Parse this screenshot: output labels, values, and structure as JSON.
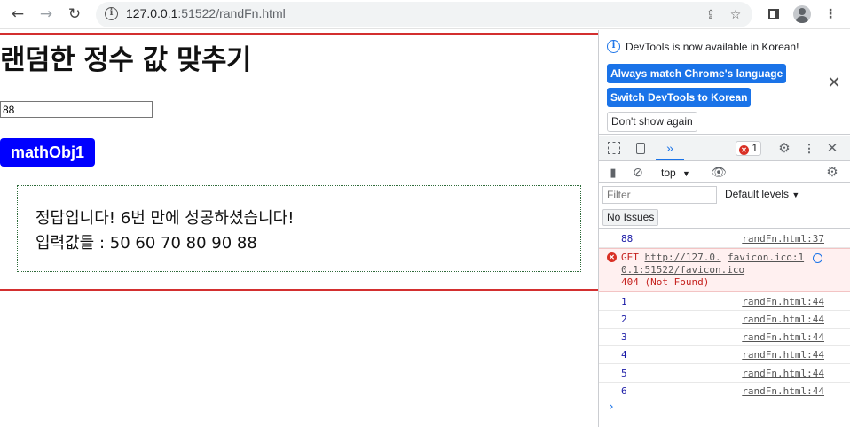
{
  "browser": {
    "url_host": "127.0.0.1",
    "url_rest": ":51522/randFn.html"
  },
  "page": {
    "title": "랜덤한 정수 값 맞추기",
    "input_value": "88",
    "button_label": "mathObj1",
    "result_line1": "정답입니다! 6번 만에 성공하셨습니다!",
    "result_line2": "입력값들 : 50 60 70 80 90 88"
  },
  "devtools": {
    "notice_text": "DevTools is now available in Korean!",
    "btn_match": "Always match Chrome's language",
    "btn_switch": "Switch DevTools to Korean",
    "btn_dont_show": "Don't show again",
    "error_count": "1",
    "context": "top",
    "filter_placeholder": "Filter",
    "levels": "Default levels",
    "issues": "No Issues",
    "logs": [
      {
        "value": "88",
        "source": "randFn.html:37"
      },
      {
        "value": "1",
        "source": "randFn.html:44"
      },
      {
        "value": "2",
        "source": "randFn.html:44"
      },
      {
        "value": "3",
        "source": "randFn.html:44"
      },
      {
        "value": "4",
        "source": "randFn.html:44"
      },
      {
        "value": "5",
        "source": "randFn.html:44"
      },
      {
        "value": "6",
        "source": "randFn.html:44"
      }
    ],
    "error": {
      "method": "GET",
      "url_part1": "http://127.0.",
      "url_part2": "0.1:51522/favicon.ico",
      "status": "404 (Not Found)",
      "source_line1": "favicon.ico:1"
    }
  }
}
